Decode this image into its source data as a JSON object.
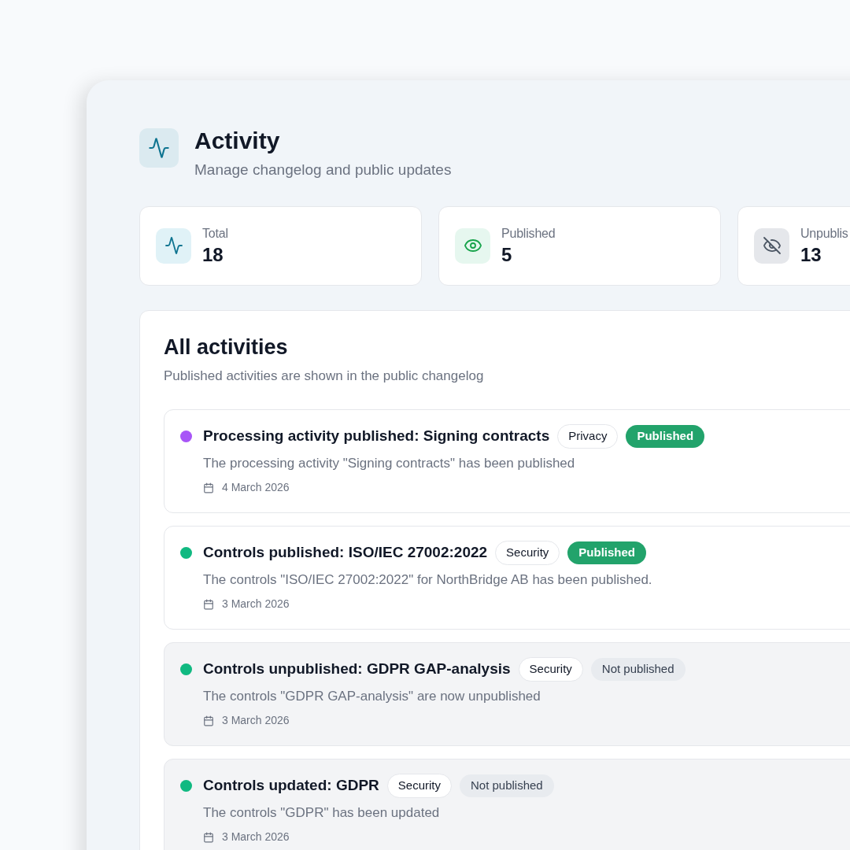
{
  "header": {
    "title": "Activity",
    "subtitle": "Manage changelog and public updates"
  },
  "stats": [
    {
      "kind": "activity",
      "label": "Total",
      "value": "18"
    },
    {
      "kind": "eye",
      "label": "Published",
      "value": "5"
    },
    {
      "kind": "eye-off",
      "label": "Unpublis",
      "value": "13"
    }
  ],
  "list": {
    "title": "All activities",
    "subtitle": "Published activities are shown in the public changelog",
    "items": [
      {
        "color": "#a855f7",
        "title": "Processing activity published: Signing contracts",
        "category": "Privacy",
        "published": true,
        "status": "Published",
        "description": "The processing activity \"Signing contracts\" has been published",
        "date": "4 March 2026"
      },
      {
        "color": "#10b981",
        "title": "Controls published: ISO/IEC 27002:2022",
        "category": "Security",
        "published": true,
        "status": "Published",
        "description": "The controls \"ISO/IEC 27002:2022\" for NorthBridge AB has been published.",
        "date": "3 March 2026"
      },
      {
        "color": "#10b981",
        "title": "Controls unpublished: GDPR GAP-analysis",
        "category": "Security",
        "published": false,
        "status": "Not published",
        "description": "The controls \"GDPR GAP-analysis\" are now unpublished",
        "date": "3 March 2026"
      },
      {
        "color": "#10b981",
        "title": "Controls updated: GDPR",
        "category": "Security",
        "published": false,
        "status": "Not published",
        "description": "The controls \"GDPR\" has been updated",
        "date": "3 March 2026"
      }
    ]
  }
}
